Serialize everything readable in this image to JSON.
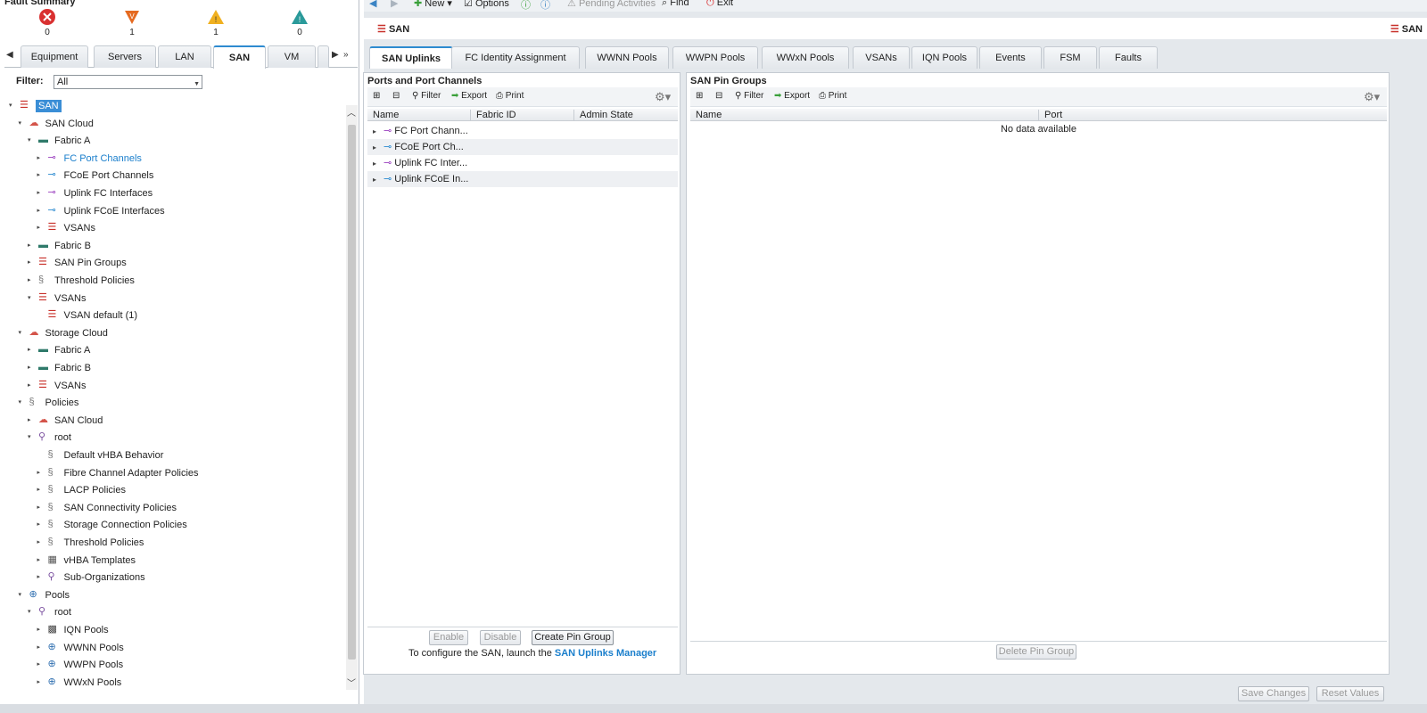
{
  "fault_summary": {
    "title": "Fault Summary",
    "items": [
      {
        "name": "critical",
        "icon": "critical-x-icon",
        "color": "#d93030",
        "count": "0"
      },
      {
        "name": "major",
        "icon": "major-triangle-icon",
        "color": "#e56a20",
        "count": "1"
      },
      {
        "name": "minor",
        "icon": "minor-warning-icon",
        "color": "#f0b020",
        "count": "1"
      },
      {
        "name": "warning",
        "icon": "info-warning-icon",
        "color": "#2a9a9a",
        "count": "0"
      }
    ]
  },
  "left_tabs": [
    "Equipment",
    "Servers",
    "LAN",
    "SAN",
    "VM"
  ],
  "left_active_tab": "SAN",
  "filter": {
    "label": "Filter:",
    "value": "All"
  },
  "tree": [
    {
      "label": "SAN",
      "level": 0,
      "toggle": "▾",
      "icon": "san-icon",
      "selected": true
    },
    {
      "label": "SAN Cloud",
      "level": 1,
      "toggle": "▾",
      "icon": "cloud-icon"
    },
    {
      "label": "Fabric A",
      "level": 2,
      "toggle": "▾",
      "icon": "fabric-icon"
    },
    {
      "label": "FC Port Channels",
      "level": 3,
      "toggle": "▸",
      "icon": "port-channel-icon",
      "link": true
    },
    {
      "label": "FCoE Port Channels",
      "level": 3,
      "toggle": "▸",
      "icon": "port-channel-blue-icon"
    },
    {
      "label": "Uplink FC Interfaces",
      "level": 3,
      "toggle": "▸",
      "icon": "port-channel-icon"
    },
    {
      "label": "Uplink FCoE Interfaces",
      "level": 3,
      "toggle": "▸",
      "icon": "port-channel-blue-icon"
    },
    {
      "label": "VSANs",
      "level": 3,
      "toggle": "▸",
      "icon": "san-icon"
    },
    {
      "label": "Fabric B",
      "level": 2,
      "toggle": "▸",
      "icon": "fabric-icon"
    },
    {
      "label": "SAN Pin Groups",
      "level": 2,
      "toggle": "▸",
      "icon": "san-icon"
    },
    {
      "label": "Threshold Policies",
      "level": 2,
      "toggle": "▸",
      "icon": "policy-icon"
    },
    {
      "label": "VSANs",
      "level": 2,
      "toggle": "▾",
      "icon": "san-icon"
    },
    {
      "label": "VSAN default (1)",
      "level": 3,
      "toggle": "",
      "icon": "san-icon"
    },
    {
      "label": "Storage Cloud",
      "level": 1,
      "toggle": "▾",
      "icon": "cloud-icon"
    },
    {
      "label": "Fabric A",
      "level": 2,
      "toggle": "▸",
      "icon": "fabric-icon"
    },
    {
      "label": "Fabric B",
      "level": 2,
      "toggle": "▸",
      "icon": "fabric-icon"
    },
    {
      "label": "VSANs",
      "level": 2,
      "toggle": "▸",
      "icon": "san-icon"
    },
    {
      "label": "Policies",
      "level": 1,
      "toggle": "▾",
      "icon": "policy-icon"
    },
    {
      "label": "SAN Cloud",
      "level": 2,
      "toggle": "▸",
      "icon": "cloud-icon"
    },
    {
      "label": "root",
      "level": 2,
      "toggle": "▾",
      "icon": "org-icon"
    },
    {
      "label": "Default vHBA Behavior",
      "level": 3,
      "toggle": "",
      "icon": "policy-icon"
    },
    {
      "label": "Fibre Channel Adapter Policies",
      "level": 3,
      "toggle": "▸",
      "icon": "policy-icon"
    },
    {
      "label": "LACP Policies",
      "level": 3,
      "toggle": "▸",
      "icon": "policy-icon"
    },
    {
      "label": "SAN Connectivity Policies",
      "level": 3,
      "toggle": "▸",
      "icon": "policy-icon"
    },
    {
      "label": "Storage Connection Policies",
      "level": 3,
      "toggle": "▸",
      "icon": "policy-icon"
    },
    {
      "label": "Threshold Policies",
      "level": 3,
      "toggle": "▸",
      "icon": "policy-icon"
    },
    {
      "label": "vHBA Templates",
      "level": 3,
      "toggle": "▸",
      "icon": "template-icon"
    },
    {
      "label": "Sub-Organizations",
      "level": 3,
      "toggle": "▸",
      "icon": "org-icon"
    },
    {
      "label": "Pools",
      "level": 1,
      "toggle": "▾",
      "icon": "pool-icon"
    },
    {
      "label": "root",
      "level": 2,
      "toggle": "▾",
      "icon": "org-icon"
    },
    {
      "label": "IQN Pools",
      "level": 3,
      "toggle": "▸",
      "icon": "iqn-icon"
    },
    {
      "label": "WWNN Pools",
      "level": 3,
      "toggle": "▸",
      "icon": "pool-icon"
    },
    {
      "label": "WWPN Pools",
      "level": 3,
      "toggle": "▸",
      "icon": "pool-icon"
    },
    {
      "label": "WWxN Pools",
      "level": 3,
      "toggle": "▸",
      "icon": "pool-icon"
    }
  ],
  "toolbar": {
    "new_label": "New",
    "options_label": "Options",
    "pending_label": "Pending Activities",
    "find_label": "Find",
    "exit_label": "Exit"
  },
  "breadcrumb": "SAN",
  "breadcrumb_right": "SAN",
  "main_tabs": [
    "SAN Uplinks",
    "FC Identity Assignment",
    "WWNN Pools",
    "WWPN Pools",
    "WWxN Pools",
    "VSANs",
    "IQN Pools",
    "Events",
    "FSM",
    "Faults"
  ],
  "ports_panel": {
    "title": "Ports and Port Channels",
    "filter_label": "Filter",
    "export_label": "Export",
    "print_label": "Print",
    "columns": [
      "Name",
      "Fabric ID",
      "Admin State"
    ],
    "rows": [
      {
        "name": "FC Port Chann...",
        "icon": "port-channel-icon"
      },
      {
        "name": "FCoE Port Ch...",
        "icon": "port-channel-blue-icon"
      },
      {
        "name": "Uplink FC Inter...",
        "icon": "port-channel-icon"
      },
      {
        "name": "Uplink FCoE In...",
        "icon": "port-channel-blue-icon"
      }
    ],
    "enable_label": "Enable",
    "disable_label": "Disable",
    "create_pin_group_label": "Create Pin Group",
    "config_text": "To configure the SAN, launch the",
    "config_link": "SAN Uplinks Manager"
  },
  "pin_panel": {
    "title": "SAN Pin Groups",
    "filter_label": "Filter",
    "export_label": "Export",
    "print_label": "Print",
    "columns": [
      "Name",
      "Port"
    ],
    "empty_text": "No data available",
    "delete_label": "Delete Pin Group"
  },
  "footer": {
    "save_label": "Save Changes",
    "reset_label": "Reset Values"
  }
}
